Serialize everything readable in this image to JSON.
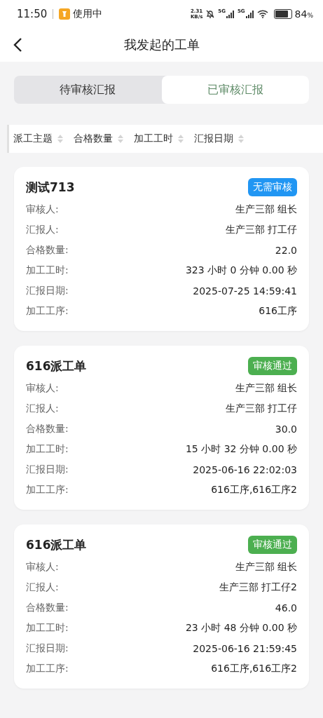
{
  "status_bar": {
    "time": "11:50",
    "app_label": "使用中",
    "net_speed": "2.31",
    "net_unit": "KB/s",
    "signal_1": "5G",
    "signal_2": "5G",
    "battery": "84",
    "battery_unit": "%"
  },
  "header": {
    "title": "我发起的工单"
  },
  "tabs": [
    {
      "label": "待审核汇报",
      "selected": false
    },
    {
      "label": "已审核汇报",
      "selected": true
    }
  ],
  "sort_columns": [
    {
      "label": "派工主题"
    },
    {
      "label": "合格数量"
    },
    {
      "label": "加工工时"
    },
    {
      "label": "汇报日期"
    }
  ],
  "cards": [
    {
      "title": "测试713",
      "status": "无需审核",
      "color": "#2196f3",
      "fields": [
        {
          "label": "审核人:",
          "value": "生产三部 组长"
        },
        {
          "label": "汇报人:",
          "value": "生产三部 打工仔"
        },
        {
          "label": "合格数量:",
          "value": "22.0"
        },
        {
          "label": "加工工时:",
          "value": "323 小时 0 分钟 0.00 秒"
        },
        {
          "label": "汇报日期:",
          "value": "2025-07-25 14:59:41"
        },
        {
          "label": "加工工序:",
          "value": "616工序"
        }
      ]
    },
    {
      "title": "616派工单",
      "status": "审核通过",
      "color": "#4caf50",
      "fields": [
        {
          "label": "审核人:",
          "value": "生产三部 组长"
        },
        {
          "label": "汇报人:",
          "value": "生产三部 打工仔"
        },
        {
          "label": "合格数量:",
          "value": "30.0"
        },
        {
          "label": "加工工时:",
          "value": "15 小时 32 分钟 0.00 秒"
        },
        {
          "label": "汇报日期:",
          "value": "2025-06-16 22:02:03"
        },
        {
          "label": "加工工序:",
          "value": "616工序,616工序2"
        }
      ]
    },
    {
      "title": "616派工单",
      "status": "审核通过",
      "color": "#4caf50",
      "fields": [
        {
          "label": "审核人:",
          "value": "生产三部 组长"
        },
        {
          "label": "汇报人:",
          "value": "生产三部 打工仔2"
        },
        {
          "label": "合格数量:",
          "value": "46.0"
        },
        {
          "label": "加工工时:",
          "value": "23 小时 48 分钟 0.00 秒"
        },
        {
          "label": "汇报日期:",
          "value": "2025-06-16 21:59:45"
        },
        {
          "label": "加工工序:",
          "value": "616工序,616工序2"
        }
      ]
    }
  ]
}
